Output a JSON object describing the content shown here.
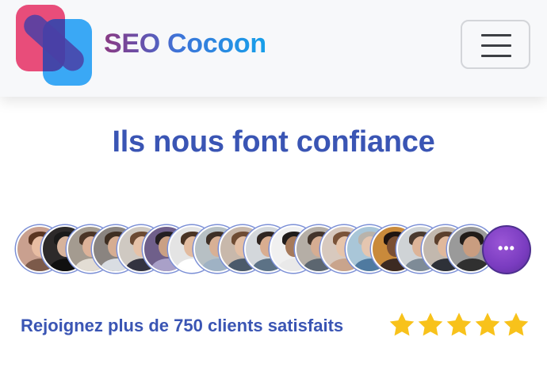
{
  "navbar": {
    "brand_name": "SEO Cocoon",
    "logo_icon": "cocoon-logo-icon",
    "menu_icon": "hamburger-menu-icon",
    "colors": {
      "logo_pink": "#e84d7a",
      "logo_blue": "#3aa8f5",
      "logo_purple": "#4446a8"
    }
  },
  "trust": {
    "headline": "Ils nous font confiance",
    "avatar_count": 18,
    "more_icon": "ellipsis-icon",
    "more_label": "•••",
    "clients_text": "Rejoignez plus de 750 clients satisfaits",
    "rating": 5,
    "rating_max": 5,
    "colors": {
      "accent": "#3a55b4",
      "star": "#f8c21b",
      "more_bubble": "#7a3cc0"
    }
  }
}
